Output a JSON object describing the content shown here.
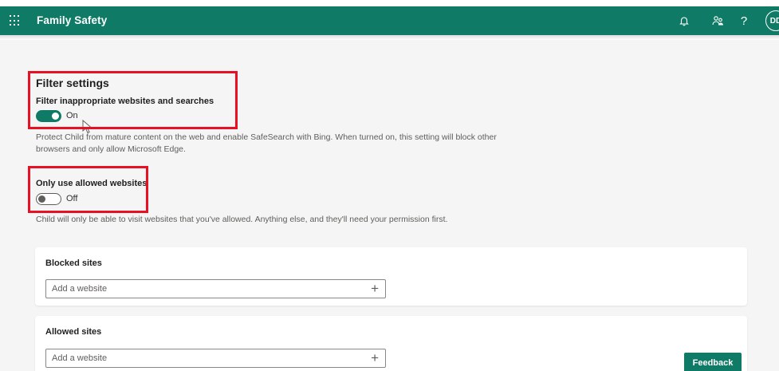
{
  "header": {
    "title": "Family Safety",
    "avatar_initials": "DD",
    "icons": [
      "waffle-icon",
      "bell-icon",
      "people-icon",
      "help-icon"
    ],
    "help_glyph": "?"
  },
  "filter_settings": {
    "title": "Filter settings",
    "filter_label": "Filter inappropriate websites and searches",
    "filter_state": "On",
    "filter_description": "Protect Child from mature content on the web and enable SafeSearch with Bing. When turned on, this setting will block other browsers and only allow Microsoft Edge.",
    "allowed_only_label": "Only use allowed websites",
    "allowed_only_state": "Off",
    "allowed_only_description": "Child will only be able to visit websites that you've allowed. Anything else, and they'll need your permission first."
  },
  "blocked_sites": {
    "title": "Blocked sites",
    "placeholder": "Add a website"
  },
  "allowed_sites": {
    "title": "Allowed sites",
    "placeholder": "Add a website"
  },
  "feedback_label": "Feedback",
  "colors": {
    "brand": "#0f7b66",
    "highlight": "#e81123",
    "background": "#f5f5f5"
  }
}
